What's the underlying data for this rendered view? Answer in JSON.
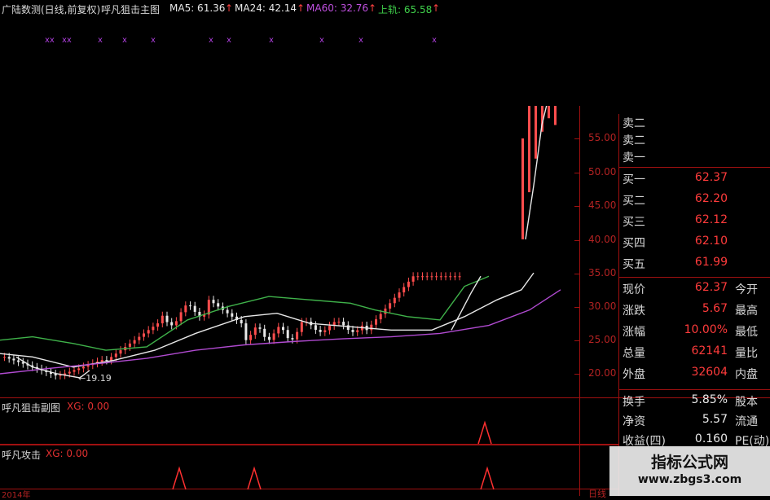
{
  "header": {
    "title": "广陆数测(日线,前复权)",
    "indicator": "呼凡狙击主图",
    "ma5": "MA5: 61.36",
    "ma24": "MA24: 42.14",
    "ma60": "MA60: 32.76",
    "upper": "上轨: 65.58"
  },
  "axis": {
    "ticks": [
      "55.00",
      "50.00",
      "45.00",
      "40.00",
      "35.00",
      "30.00",
      "25.00",
      "20.00"
    ]
  },
  "main_chart": {
    "low_label": "←19.19",
    "colors": {
      "up": "#ff4d4d",
      "down": "#e8e8e8",
      "ma_green": "#3fb24a",
      "ma_white": "#e8e8e8",
      "ma_purple": "#b04ad0",
      "signal": "#b040e0"
    },
    "signal_markers": [
      "xx",
      "xx",
      "x",
      "x",
      "x",
      "x",
      "x",
      "x",
      "x",
      "x",
      "x"
    ]
  },
  "sub1": {
    "title": "呼凡狙击副图",
    "xg": "XG: 0.00"
  },
  "sub2": {
    "title": "呼凡攻击",
    "xg": "XG: 0.00"
  },
  "bottom_axis": {
    "left_label": "2014年",
    "right_label": "日线"
  },
  "quote_panel": {
    "sell": [
      {
        "label": "卖二"
      },
      {
        "label": "卖二"
      },
      {
        "label": "卖一"
      }
    ],
    "buy": [
      {
        "label": "买一",
        "value": "62.37"
      },
      {
        "label": "买二",
        "value": "62.20"
      },
      {
        "label": "买三",
        "value": "62.12"
      },
      {
        "label": "买四",
        "value": "62.10"
      },
      {
        "label": "买五",
        "value": "61.99"
      }
    ],
    "stats": [
      {
        "label": "现价",
        "value": "62.37",
        "label2": "今开"
      },
      {
        "label": "涨跌",
        "value": "5.67",
        "label2": "最高"
      },
      {
        "label": "涨幅",
        "value": "10.00%",
        "label2": "最低"
      },
      {
        "label": "总量",
        "value": "62141",
        "label2": "量比"
      },
      {
        "label": "外盘",
        "value": "32604",
        "label2": "内盘"
      }
    ],
    "extra": [
      {
        "label": "换手",
        "value": "5.85%",
        "label2": "股本"
      },
      {
        "label": "净资",
        "value": "5.57",
        "label2": "流通"
      },
      {
        "label": "收益(四)",
        "value": "0.160",
        "label2": "PE(动)"
      }
    ]
  },
  "watermark": {
    "title": "指标公式网",
    "url": "www.zbgs3.com"
  }
}
